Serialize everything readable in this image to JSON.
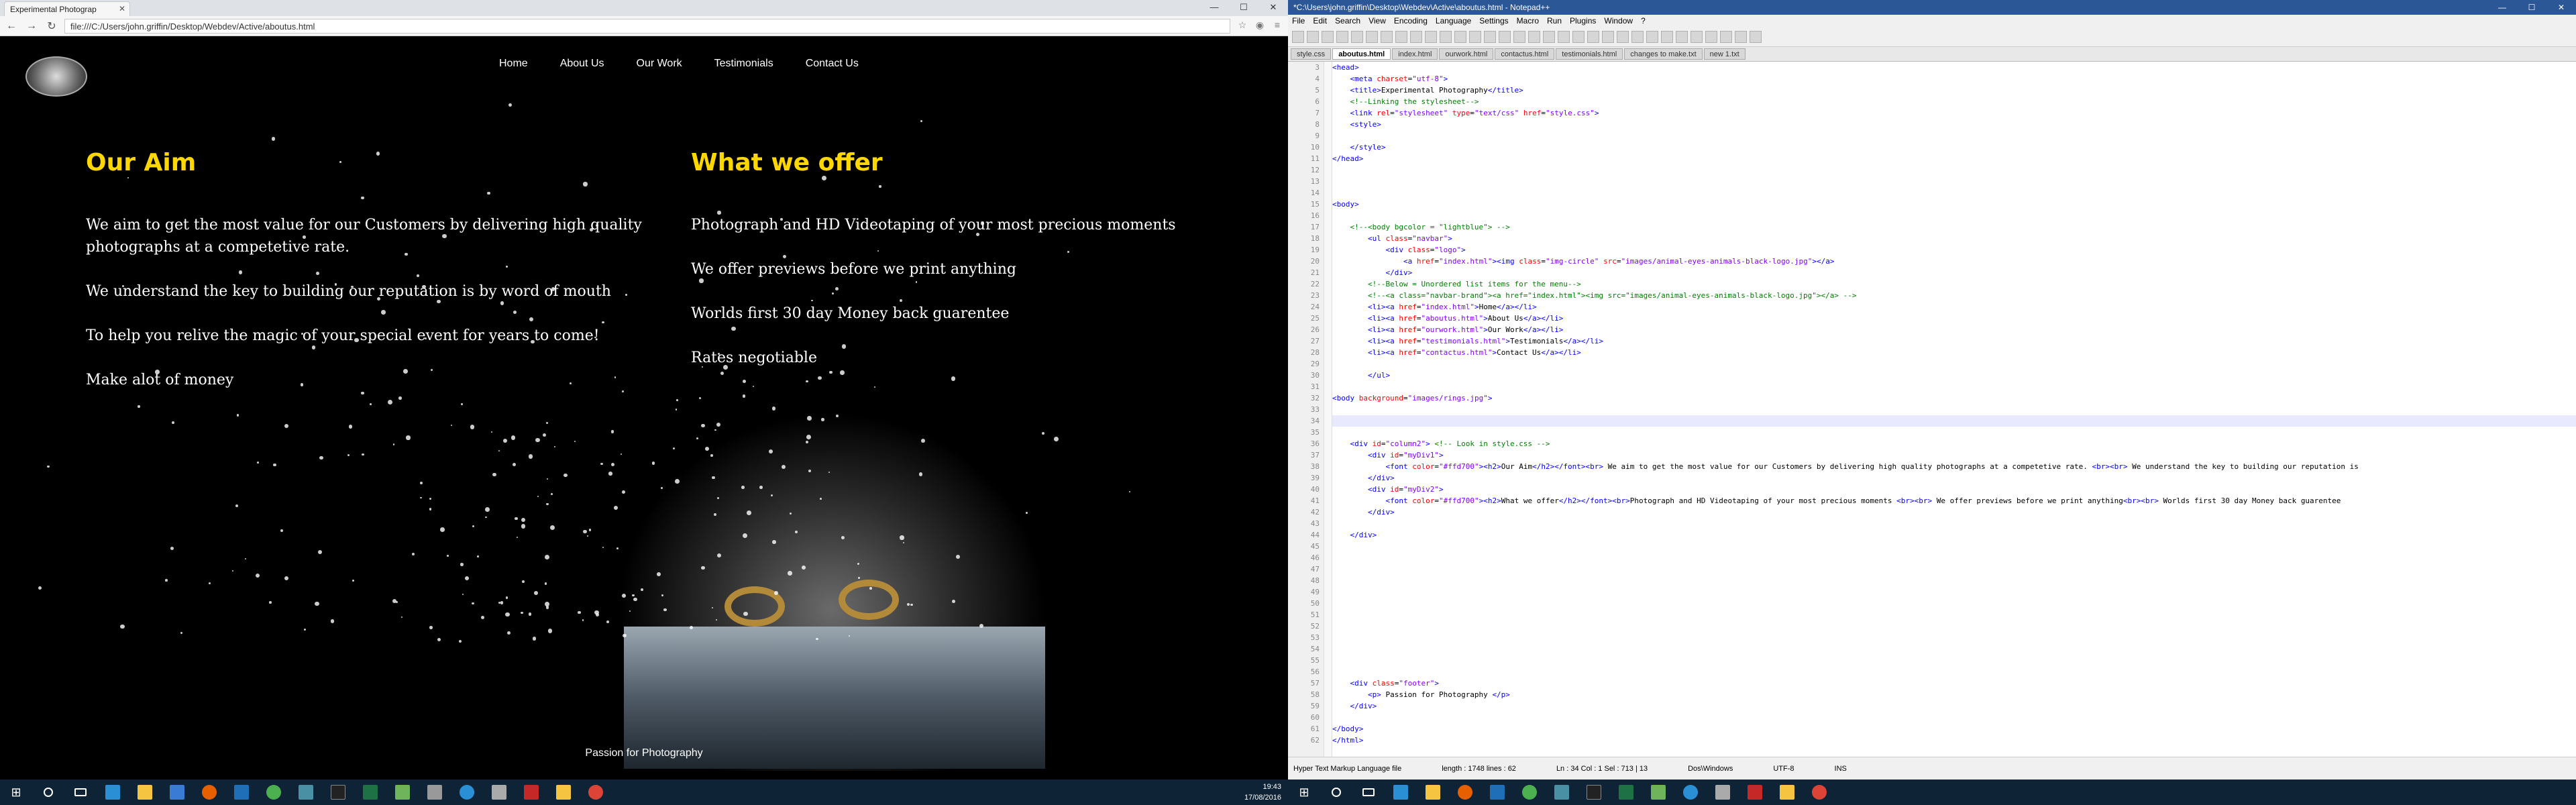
{
  "browser": {
    "tab_title": "Experimental Photograp",
    "url": "file:///C:/Users/john.griffin/Desktop/Webdev/Active/aboutus.html"
  },
  "site": {
    "nav": [
      "Home",
      "About Us",
      "Our Work",
      "Testimonials",
      "Contact Us"
    ],
    "aim": {
      "heading": "Our Aim",
      "items": [
        "We aim to get the most value for our Customers by delivering high quality photographs at a competetive rate.",
        "We understand the key to building our reputation is by word of mouth",
        "To help you relive the magic of your special event for years to come!",
        "Make alot of money"
      ]
    },
    "offer": {
      "heading": "What we offer",
      "items": [
        "Photograph and HD Videotaping of your most precious moments",
        "We offer previews before we print anything",
        "Worlds first 30 day Money back guarentee",
        "Rates negotiable"
      ]
    },
    "footer": "Passion for Photography"
  },
  "npp": {
    "title": "*C:\\Users\\john.griffin\\Desktop\\Webdev\\Active\\aboutus.html - Notepad++",
    "menu": [
      "File",
      "Edit",
      "Search",
      "View",
      "Encoding",
      "Language",
      "Settings",
      "Macro",
      "Run",
      "Plugins",
      "Window",
      "?"
    ],
    "tabs": [
      "style.css",
      "aboutus.html",
      "index.html",
      "ourwork.html",
      "contactus.html",
      "testimonials.html",
      "changes to make.txt",
      "new 1.txt"
    ],
    "active_tab": "aboutus.html",
    "status": {
      "type": "Hyper Text Markup Language file",
      "length": "length : 1748   lines : 62",
      "pos": "Ln : 34    Col : 1    Sel : 713 | 13",
      "eol": "Dos\\Windows",
      "enc": "UTF-8",
      "ins": "INS"
    }
  },
  "code_lines": [
    {
      "n": "3",
      "html": "<span class='tag'>&lt;head&gt;</span>"
    },
    {
      "n": "4",
      "html": "    <span class='tag'>&lt;meta</span> <span class='attr'>charset</span>=<span class='str'>\"utf-8\"</span><span class='tag'>&gt;</span>"
    },
    {
      "n": "5",
      "html": "    <span class='tag'>&lt;title&gt;</span>Experimental Photography<span class='tag'>&lt;/title&gt;</span>"
    },
    {
      "n": "6",
      "html": "    <span class='cmt'>&lt;!--Linking the stylesheet--&gt;</span>"
    },
    {
      "n": "7",
      "html": "    <span class='tag'>&lt;link</span> <span class='attr'>rel</span>=<span class='str'>\"stylesheet\"</span> <span class='attr'>type</span>=<span class='str'>\"text/css\"</span> <span class='attr'>href</span>=<span class='str'>\"style.css\"</span><span class='tag'>&gt;</span>"
    },
    {
      "n": "8",
      "html": "    <span class='tag'>&lt;style&gt;</span>"
    },
    {
      "n": "9",
      "html": ""
    },
    {
      "n": "10",
      "html": "    <span class='tag'>&lt;/style&gt;</span>"
    },
    {
      "n": "11",
      "html": "<span class='tag'>&lt;/head&gt;</span>"
    },
    {
      "n": "12",
      "html": ""
    },
    {
      "n": "13",
      "html": ""
    },
    {
      "n": "14",
      "html": ""
    },
    {
      "n": "15",
      "html": "<span class='tag'>&lt;body&gt;</span>"
    },
    {
      "n": "16",
      "html": ""
    },
    {
      "n": "17",
      "html": "    <span class='cmt'>&lt;!--&lt;body bgcolor = \"lightblue\"&gt; --&gt;</span>"
    },
    {
      "n": "18",
      "html": "        <span class='tag'>&lt;ul</span> <span class='attr'>class</span>=<span class='str'>\"navbar\"</span><span class='tag'>&gt;</span>"
    },
    {
      "n": "19",
      "html": "            <span class='tag'>&lt;div</span> <span class='attr'>class</span>=<span class='str'>\"logo\"</span><span class='tag'>&gt;</span>"
    },
    {
      "n": "20",
      "html": "                <span class='tag'>&lt;a</span> <span class='attr'>href</span>=<span class='str'>\"index.html\"</span><span class='tag'>&gt;&lt;img</span> <span class='attr'>class</span>=<span class='str'>\"img-circle\"</span> <span class='attr'>src</span>=<span class='str'>\"images/animal-eyes-animals-black-logo.jpg\"</span><span class='tag'>&gt;&lt;/a&gt;</span>"
    },
    {
      "n": "21",
      "html": "            <span class='tag'>&lt;/div&gt;</span>"
    },
    {
      "n": "22",
      "html": "        <span class='cmt'>&lt;!--Below = Unordered list items for the menu--&gt;</span>"
    },
    {
      "n": "23",
      "html": "        <span class='cmt'>&lt;!--&lt;a class=\"navbar-brand\"&gt;&lt;a href=\"index.html\"&gt;&lt;img src=\"images/animal-eyes-animals-black-logo.jpg\"&gt;&lt;/a&gt; --&gt;</span>"
    },
    {
      "n": "24",
      "html": "        <span class='tag'>&lt;li&gt;&lt;a</span> <span class='attr'>href</span>=<span class='str'>\"index.html\"</span><span class='tag'>&gt;</span>Home<span class='tag'>&lt;/a&gt;&lt;/li&gt;</span>"
    },
    {
      "n": "25",
      "html": "        <span class='tag'>&lt;li&gt;&lt;a</span> <span class='attr'>href</span>=<span class='str'>\"aboutus.html\"</span><span class='tag'>&gt;</span>About Us<span class='tag'>&lt;/a&gt;&lt;/li&gt;</span>"
    },
    {
      "n": "26",
      "html": "        <span class='tag'>&lt;li&gt;&lt;a</span> <span class='attr'>href</span>=<span class='str'>\"ourwork.html\"</span><span class='tag'>&gt;</span>Our Work<span class='tag'>&lt;/a&gt;&lt;/li&gt;</span>"
    },
    {
      "n": "27",
      "html": "        <span class='tag'>&lt;li&gt;&lt;a</span> <span class='attr'>href</span>=<span class='str'>\"testimonials.html\"</span><span class='tag'>&gt;</span>Testimonials<span class='tag'>&lt;/a&gt;&lt;/li&gt;</span>"
    },
    {
      "n": "28",
      "html": "        <span class='tag'>&lt;li&gt;&lt;a</span> <span class='attr'>href</span>=<span class='str'>\"contactus.html\"</span><span class='tag'>&gt;</span>Contact Us<span class='tag'>&lt;/a&gt;&lt;/li&gt;</span>"
    },
    {
      "n": "29",
      "html": ""
    },
    {
      "n": "30",
      "html": "        <span class='tag'>&lt;/ul&gt;</span>"
    },
    {
      "n": "31",
      "html": ""
    },
    {
      "n": "32",
      "html": "<span class='tag'>&lt;body</span> <span class='attr'>background</span>=<span class='str'>\"images/rings.jpg\"</span><span class='tag'>&gt;</span>"
    },
    {
      "n": "33",
      "html": ""
    },
    {
      "n": "34",
      "html": "",
      "hl": true
    },
    {
      "n": "35",
      "html": ""
    },
    {
      "n": "36",
      "html": "    <span class='tag'>&lt;div</span> <span class='attr'>id</span>=<span class='str'>\"column2\"</span><span class='tag'>&gt;</span> <span class='cmt'>&lt;!-- Look in style.css --&gt;</span>"
    },
    {
      "n": "37",
      "html": "        <span class='tag'>&lt;div</span> <span class='attr'>id</span>=<span class='str'>\"myDiv1\"</span><span class='tag'>&gt;</span>"
    },
    {
      "n": "38",
      "html": "            <span class='tag'>&lt;font</span> <span class='attr'>color</span>=<span class='str'>\"#ffd700\"</span><span class='tag'>&gt;&lt;h2&gt;</span>Our Aim<span class='tag'>&lt;/h2&gt;&lt;/font&gt;&lt;br&gt;</span> We aim to get the most value for our Customers by delivering high quality photographs at a competetive rate. <span class='tag'>&lt;br&gt;&lt;br&gt;</span> We understand the key to building our reputation is"
    },
    {
      "n": "39",
      "html": "        <span class='tag'>&lt;/div&gt;</span>"
    },
    {
      "n": "40",
      "html": "        <span class='tag'>&lt;div</span> <span class='attr'>id</span>=<span class='str'>\"myDiv2\"</span><span class='tag'>&gt;</span>"
    },
    {
      "n": "41",
      "html": "            <span class='tag'>&lt;font</span> <span class='attr'>color</span>=<span class='str'>\"#ffd700\"</span><span class='tag'>&gt;&lt;h2&gt;</span>What we offer<span class='tag'>&lt;/h2&gt;&lt;/font&gt;&lt;br&gt;</span>Photograph and HD Videotaping of your most precious moments <span class='tag'>&lt;br&gt;&lt;br&gt;</span> We offer previews before we print anything<span class='tag'>&lt;br&gt;&lt;br&gt;</span> Worlds first 30 day Money back guarentee"
    },
    {
      "n": "42",
      "html": "        <span class='tag'>&lt;/div&gt;</span>"
    },
    {
      "n": "43",
      "html": ""
    },
    {
      "n": "44",
      "html": "    <span class='tag'>&lt;/div&gt;</span>"
    },
    {
      "n": "45",
      "html": ""
    },
    {
      "n": "46",
      "html": ""
    },
    {
      "n": "47",
      "html": ""
    },
    {
      "n": "48",
      "html": ""
    },
    {
      "n": "49",
      "html": ""
    },
    {
      "n": "50",
      "html": ""
    },
    {
      "n": "51",
      "html": ""
    },
    {
      "n": "52",
      "html": ""
    },
    {
      "n": "53",
      "html": ""
    },
    {
      "n": "54",
      "html": ""
    },
    {
      "n": "55",
      "html": ""
    },
    {
      "n": "56",
      "html": ""
    },
    {
      "n": "57",
      "html": "    <span class='tag'>&lt;div</span> <span class='attr'>class</span>=<span class='str'>\"footer\"</span><span class='tag'>&gt;</span>"
    },
    {
      "n": "58",
      "html": "        <span class='tag'>&lt;p&gt;</span> Passion for Photography <span class='tag'>&lt;/p&gt;</span>"
    },
    {
      "n": "59",
      "html": "    <span class='tag'>&lt;/div&gt;</span>"
    },
    {
      "n": "60",
      "html": ""
    },
    {
      "n": "61",
      "html": "<span class='tag'>&lt;/body&gt;</span>"
    },
    {
      "n": "62",
      "html": "<span class='tag'>&lt;/html&gt;</span>"
    }
  ],
  "taskbar": {
    "time": "19:43",
    "date": "17/08/2016"
  }
}
